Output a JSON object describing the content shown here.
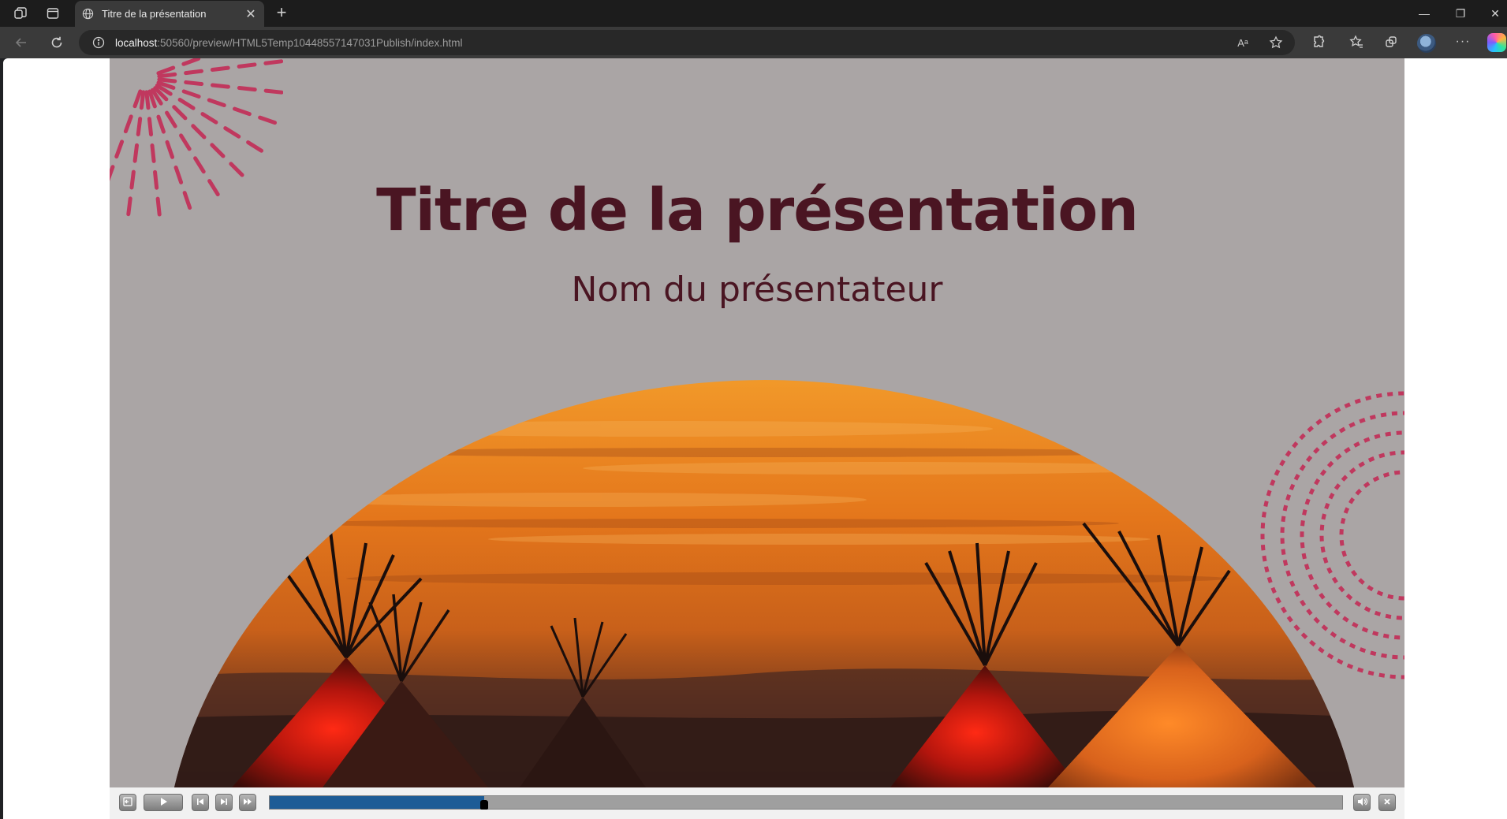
{
  "browser": {
    "tab": {
      "title": "Titre de la présentation",
      "close_glyph": "✕"
    },
    "new_tab_glyph": "+",
    "window_controls": {
      "minimize": "—",
      "maximize": "❐",
      "close": "✕"
    },
    "address_bar": {
      "host": "localhost",
      "rest": ":50560/preview/HTML5Temp10448557147031Publish/index.html",
      "read_aloud_glyph": "Aᵃ"
    },
    "menu_glyph": "···"
  },
  "slide": {
    "title": "Titre de la présentation",
    "subtitle": "Nom du présentateur",
    "colors": {
      "background": "#aaa5a5",
      "text": "#4a1522",
      "accent": "#c0385e"
    }
  },
  "player": {
    "progress": 0.2,
    "colors": {
      "fill": "#1d5c96",
      "track": "#9f9f9f"
    }
  }
}
